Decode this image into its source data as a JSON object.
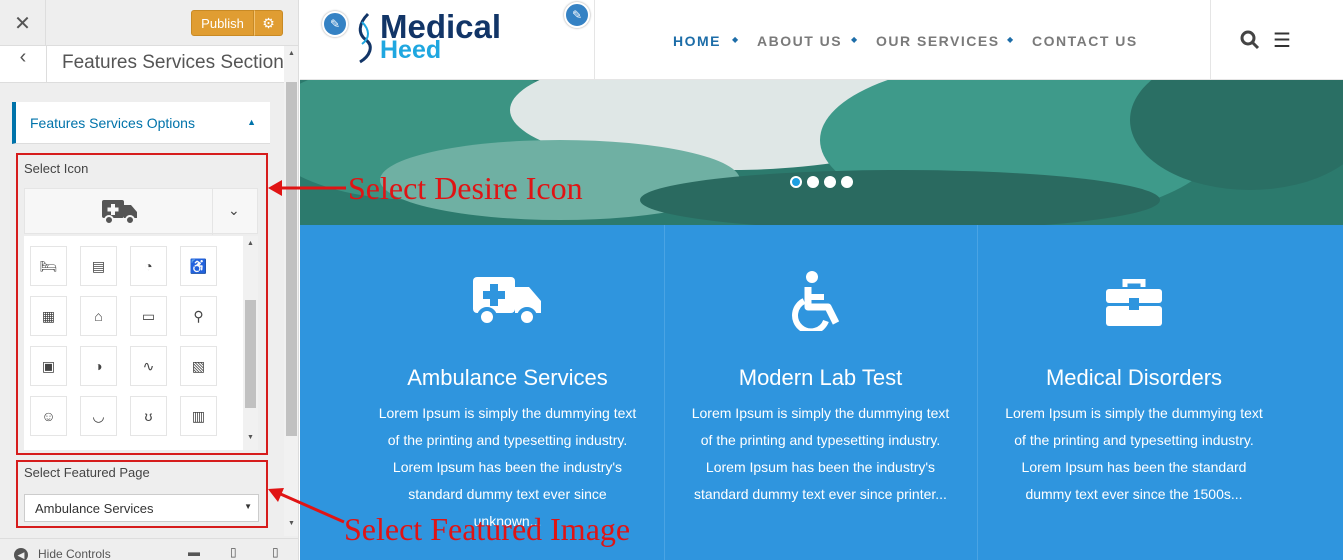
{
  "sidebar": {
    "close": "✕",
    "publish": "Publish",
    "gear": "⚙",
    "back": "‹",
    "section_title": "Features Services Section",
    "options_title": "Features Services Options",
    "select_icon_label": "Select Icon",
    "featured_page_label": "Select Featured Page",
    "featured_page_value": "Ambulance Services",
    "hide_controls": "Hide Controls"
  },
  "header": {
    "nav": [
      "HOME",
      "ABOUT US",
      "OUR SERVICES",
      "CONTACT US"
    ],
    "logo_line1": "Medical",
    "logo_line2": "Heed"
  },
  "services": [
    {
      "title": "Ambulance Services",
      "lines": [
        "Lorem Ipsum is simply the dummying text",
        "of the printing and typesetting industry.",
        "Lorem Ipsum has been the industry's",
        "standard dummy text ever since",
        "unknown..."
      ]
    },
    {
      "title": "Modern Lab Test",
      "lines": [
        "Lorem Ipsum is simply the dummying text",
        "of the printing and typesetting industry.",
        "Lorem Ipsum has been the industry's",
        "standard dummy text ever since printer..."
      ]
    },
    {
      "title": "Medical Disorders",
      "lines": [
        "Lorem Ipsum is simply the dummying text",
        "of the printing and typesetting industry.",
        "Lorem Ipsum has been the standard",
        "dummy text ever since the 1500s..."
      ]
    }
  ],
  "annotations": {
    "icon": "Select Desire Icon",
    "image": "Select Featured Image"
  },
  "icons": [
    "bed-icon",
    "bandage-icon",
    "hearing-icon",
    "wheelchair-icon",
    "hospital-icon",
    "bank-icon",
    "id-card-icon",
    "blind-icon",
    "medkit-icon",
    "pills-icon",
    "file-medical-icon",
    "file-plus-icon",
    "doctor-icon",
    "mortar-icon",
    "stethoscope-icon",
    "prescription-bottle-icon"
  ],
  "colors": {
    "accent": "#0073aa",
    "publish": "#e09d32",
    "feature_bg": "#2f95de",
    "annotation": "#e01414"
  }
}
